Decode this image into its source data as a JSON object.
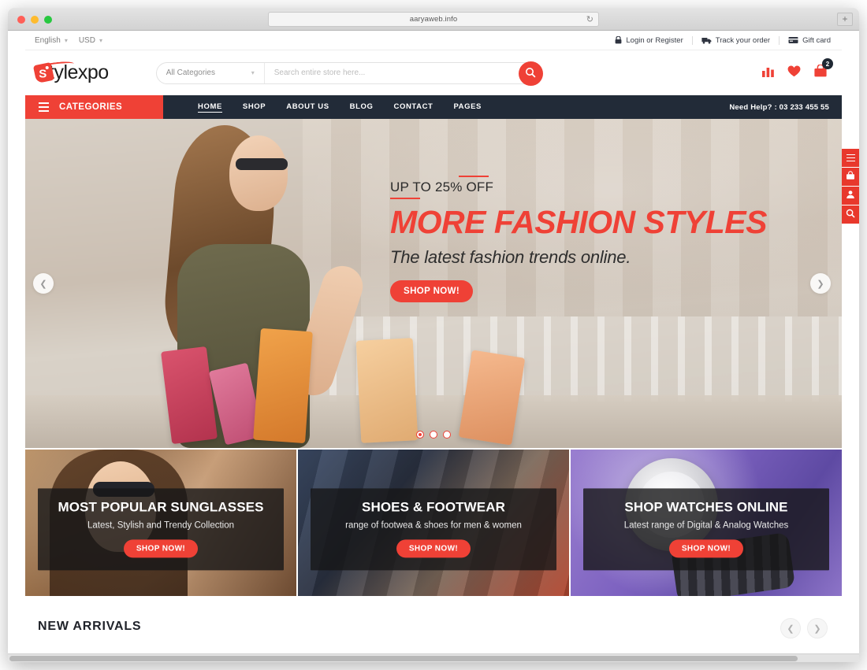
{
  "browser": {
    "url": "aaryaweb.info",
    "reload_icon": "reload-icon",
    "new_tab_label": "+"
  },
  "topbar": {
    "language": "English",
    "currency": "USD",
    "links": [
      {
        "label": "Login or Register",
        "icon": "lock-icon"
      },
      {
        "label": "Track your order",
        "icon": "truck-icon"
      },
      {
        "label": "Gift card",
        "icon": "gift-card-icon"
      }
    ]
  },
  "header": {
    "logo_mark": "S",
    "logo_text": "tylexpo",
    "search": {
      "category": "All Categories",
      "placeholder": "Search entire store here...",
      "value": "",
      "button_icon": "search-icon"
    },
    "icons": [
      {
        "name": "compare-icon"
      },
      {
        "name": "wishlist-heart-icon"
      },
      {
        "name": "cart-icon",
        "badge": "2"
      }
    ]
  },
  "nav": {
    "categories_label": "CATEGORIES",
    "links": [
      {
        "label": "HOME",
        "active": true
      },
      {
        "label": "SHOP",
        "active": false
      },
      {
        "label": "ABOUT US",
        "active": false
      },
      {
        "label": "BLOG",
        "active": false
      },
      {
        "label": "CONTACT",
        "active": false
      },
      {
        "label": "PAGES",
        "active": false
      }
    ],
    "need_help": "Need Help? : 03 233 455 55"
  },
  "hero": {
    "offer": "UP TO 25% OFF",
    "title": "MORE FASHION STYLES",
    "subtitle": "The latest fashion trends online.",
    "cta": "SHOP NOW!",
    "prev_icon": "chevron-left-icon",
    "next_icon": "chevron-right-icon",
    "slides": 3,
    "active_slide": 1
  },
  "side_toolbar": [
    {
      "name": "menu-icon"
    },
    {
      "name": "basket-icon"
    },
    {
      "name": "user-icon"
    },
    {
      "name": "search-icon"
    }
  ],
  "promos": [
    {
      "title": "MOST POPULAR SUNGLASSES",
      "subtitle": "Latest, Stylish and Trendy Collection",
      "cta": "SHOP NOW!"
    },
    {
      "title": "SHOES & FOOTWEAR",
      "subtitle": "range of footwea & shoes for men & women",
      "cta": "SHOP NOW!"
    },
    {
      "title": "SHOP WATCHES ONLINE",
      "subtitle": "Latest range of Digital & Analog Watches",
      "cta": "SHOP NOW!"
    }
  ],
  "new_arrivals": {
    "title": "NEW ARRIVALS",
    "prev_icon": "chevron-left-icon",
    "next_icon": "chevron-right-icon"
  },
  "colors": {
    "accent": "#ef4136",
    "nav_dark": "#222b38",
    "badge_dark": "#1f2833"
  }
}
